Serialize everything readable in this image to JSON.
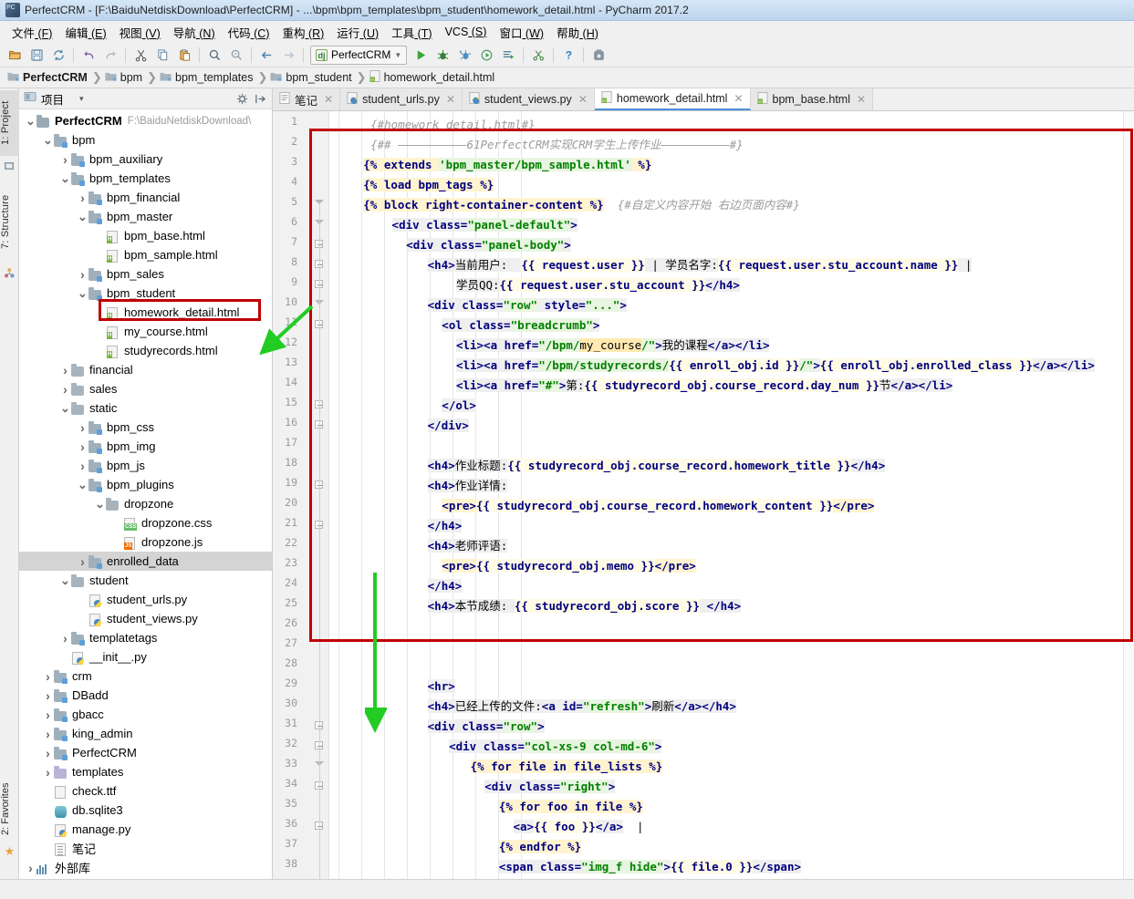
{
  "window": {
    "title": "PerfectCRM - [F:\\BaiduNetdiskDownload\\PerfectCRM] - ...\\bpm\\bpm_templates\\bpm_student\\homework_detail.html - PyCharm 2017.2",
    "app_icon": "pycharm-icon"
  },
  "menubar": {
    "items": [
      {
        "label": "文件",
        "mnemonic": "(F)"
      },
      {
        "label": "编辑",
        "mnemonic": "(E)"
      },
      {
        "label": "视图",
        "mnemonic": "(V)"
      },
      {
        "label": "导航",
        "mnemonic": "(N)"
      },
      {
        "label": "代码",
        "mnemonic": "(C)"
      },
      {
        "label": "重构",
        "mnemonic": "(R)"
      },
      {
        "label": "运行",
        "mnemonic": "(U)"
      },
      {
        "label": "工具",
        "mnemonic": "(T)"
      },
      {
        "label": "VCS",
        "mnemonic": "(S)"
      },
      {
        "label": "窗口",
        "mnemonic": "(W)"
      },
      {
        "label": "帮助",
        "mnemonic": "(H)"
      }
    ]
  },
  "toolbar": {
    "run_config": "PerfectCRM",
    "buttons": [
      "open-folder-icon",
      "save-all-icon",
      "sync-refresh-icon",
      "undo-icon",
      "redo-icon",
      "cut-icon",
      "copy-icon",
      "paste-icon",
      "find-icon",
      "replace-icon",
      "back-icon",
      "forward-icon",
      "run-icon",
      "debug-icon",
      "coverage-icon",
      "profile-icon",
      "run-with-console-icon",
      "stop-icon",
      "help-icon",
      "settings-icon"
    ]
  },
  "navbar": {
    "crumbs": [
      {
        "label": "PerfectCRM",
        "icon": "folder-icon",
        "bold": true
      },
      {
        "label": "bpm",
        "icon": "folder-icon",
        "bold": false
      },
      {
        "label": "bpm_templates",
        "icon": "folder-icon",
        "bold": false
      },
      {
        "label": "bpm_student",
        "icon": "folder-icon",
        "bold": false
      },
      {
        "label": "homework_detail.html",
        "icon": "html-file-icon",
        "bold": false
      }
    ]
  },
  "left_tool_strip": {
    "tabs": [
      {
        "label": "1: Project",
        "selected": true
      },
      {
        "label": "7: Structure",
        "selected": false
      }
    ],
    "bottom_tabs": [
      {
        "label": "2: Favorites",
        "selected": false
      }
    ]
  },
  "project_panel": {
    "title": "项目",
    "gear_icon": "gear-icon",
    "collapse_icon": "collapse-all-icon",
    "tree": [
      {
        "depth": 0,
        "arrow": "down",
        "icon": "folder-src",
        "label": "PerfectCRM",
        "bold": true,
        "path": "F:\\BaiduNetdiskDownload\\"
      },
      {
        "depth": 1,
        "arrow": "down",
        "icon": "folder-mod",
        "label": "bpm"
      },
      {
        "depth": 2,
        "arrow": "right",
        "icon": "folder-mod",
        "label": "bpm_auxiliary"
      },
      {
        "depth": 2,
        "arrow": "down",
        "icon": "folder-mod",
        "label": "bpm_templates"
      },
      {
        "depth": 3,
        "arrow": "right",
        "icon": "folder-mod",
        "label": "bpm_financial"
      },
      {
        "depth": 3,
        "arrow": "down",
        "icon": "folder-mod",
        "label": "bpm_master"
      },
      {
        "depth": 4,
        "arrow": "none",
        "icon": "file-html",
        "label": "bpm_base.html"
      },
      {
        "depth": 4,
        "arrow": "none",
        "icon": "file-html",
        "label": "bpm_sample.html"
      },
      {
        "depth": 3,
        "arrow": "right",
        "icon": "folder-mod",
        "label": "bpm_sales"
      },
      {
        "depth": 3,
        "arrow": "down",
        "icon": "folder-mod",
        "label": "bpm_student"
      },
      {
        "depth": 4,
        "arrow": "none",
        "icon": "file-html",
        "label": "homework_detail.html",
        "highlighted": true
      },
      {
        "depth": 4,
        "arrow": "none",
        "icon": "file-html",
        "label": "my_course.html"
      },
      {
        "depth": 4,
        "arrow": "none",
        "icon": "file-html",
        "label": "studyrecords.html"
      },
      {
        "depth": 2,
        "arrow": "right",
        "icon": "folder-plain",
        "label": "financial"
      },
      {
        "depth": 2,
        "arrow": "right",
        "icon": "folder-plain",
        "label": "sales"
      },
      {
        "depth": 2,
        "arrow": "down",
        "icon": "folder-plain",
        "label": "static"
      },
      {
        "depth": 3,
        "arrow": "right",
        "icon": "folder-mod",
        "label": "bpm_css"
      },
      {
        "depth": 3,
        "arrow": "right",
        "icon": "folder-mod",
        "label": "bpm_img"
      },
      {
        "depth": 3,
        "arrow": "right",
        "icon": "folder-mod",
        "label": "bpm_js"
      },
      {
        "depth": 3,
        "arrow": "down",
        "icon": "folder-mod",
        "label": "bpm_plugins"
      },
      {
        "depth": 4,
        "arrow": "down",
        "icon": "folder-plain",
        "label": "dropzone"
      },
      {
        "depth": 5,
        "arrow": "none",
        "icon": "file-css",
        "label": "dropzone.css"
      },
      {
        "depth": 5,
        "arrow": "none",
        "icon": "file-js",
        "label": "dropzone.js"
      },
      {
        "depth": 3,
        "arrow": "right",
        "icon": "folder-mod",
        "label": "enrolled_data",
        "selected": true
      },
      {
        "depth": 2,
        "arrow": "down",
        "icon": "folder-plain",
        "label": "student"
      },
      {
        "depth": 3,
        "arrow": "none",
        "icon": "file-py",
        "label": "student_urls.py"
      },
      {
        "depth": 3,
        "arrow": "none",
        "icon": "file-py",
        "label": "student_views.py"
      },
      {
        "depth": 2,
        "arrow": "right",
        "icon": "folder-mod",
        "label": "templatetags"
      },
      {
        "depth": 2,
        "arrow": "none",
        "icon": "file-py",
        "label": "__init__.py"
      },
      {
        "depth": 1,
        "arrow": "right",
        "icon": "folder-mod",
        "label": "crm"
      },
      {
        "depth": 1,
        "arrow": "right",
        "icon": "folder-mod",
        "label": "DBadd"
      },
      {
        "depth": 1,
        "arrow": "right",
        "icon": "folder-mod",
        "label": "gbacc"
      },
      {
        "depth": 1,
        "arrow": "right",
        "icon": "folder-mod",
        "label": "king_admin"
      },
      {
        "depth": 1,
        "arrow": "right",
        "icon": "folder-mod",
        "label": "PerfectCRM"
      },
      {
        "depth": 1,
        "arrow": "right",
        "icon": "folder-lav",
        "label": "templates"
      },
      {
        "depth": 1,
        "arrow": "none",
        "icon": "file-ttf",
        "label": "check.ttf"
      },
      {
        "depth": 1,
        "arrow": "none",
        "icon": "file-db",
        "label": "db.sqlite3"
      },
      {
        "depth": 1,
        "arrow": "none",
        "icon": "file-py",
        "label": "manage.py"
      },
      {
        "depth": 1,
        "arrow": "none",
        "icon": "file-txt",
        "label": "笔记"
      },
      {
        "depth": 0,
        "arrow": "right",
        "icon": "library",
        "label": "外部库"
      }
    ]
  },
  "editor": {
    "tabs": [
      {
        "label": "笔记",
        "icon": "txt-file-icon",
        "active": false
      },
      {
        "label": "student_urls.py",
        "icon": "py-file-icon",
        "active": false
      },
      {
        "label": "student_views.py",
        "icon": "py-file-icon",
        "active": false
      },
      {
        "label": "homework_detail.html",
        "icon": "html-file-icon",
        "active": true
      },
      {
        "label": "bpm_base.html",
        "icon": "html-file-icon",
        "active": false
      }
    ],
    "first_line": 1,
    "last_line": 38,
    "lines": [
      {
        "n": 1,
        "html": "<span class='t-cmt'>{#homework_detail.html#}</span>",
        "indent": 5
      },
      {
        "n": 2,
        "html": "<span class='t-cmt'>{## ——————————61PerfectCRM实现CRM学生上传作业——————————#}</span>",
        "indent": 5
      },
      {
        "n": 3,
        "html": "<span class='t-djt'>{% extends </span><span class='t-str'>'bpm_master/bpm_sample.html'</span><span class='t-djt'> %}</span>",
        "indent": 4
      },
      {
        "n": 4,
        "html": "<span class='t-djt'>{% load bpm_tags %}</span>",
        "indent": 4
      },
      {
        "n": 5,
        "html": "<span class='t-djt'>{% block right-container-content %}</span>  <span class='t-cmt'>{#自定义内容开始 右边页面内容#}</span>",
        "indent": 4
      },
      {
        "n": 6,
        "html": "<span class='t-tag'>&lt;div class=</span><span class='t-str'>\"panel-default\"</span><span class='t-tag'>&gt;</span>",
        "indent": 8
      },
      {
        "n": 7,
        "html": "<span class='t-tag'>&lt;div class=</span><span class='t-str'>\"panel-body\"</span><span class='t-tag'>&gt;</span>",
        "indent": 10
      },
      {
        "n": 8,
        "html": "<span class='t-tag'>&lt;h4&gt;</span><span class='t-txt'>当前用户:  </span><span class='t-var'>{{ request.user }}</span><span class='t-txt'> | 学员名字:</span><span class='t-var'>{{ request.user.stu_account.name }}</span><span class='t-txt'> |</span>",
        "indent": 13
      },
      {
        "n": 9,
        "html": "<span class='t-txt'>学员QQ:</span><span class='t-var'>{{ request.user.stu_account }}</span><span class='t-tag'>&lt;/h4&gt;</span>",
        "indent": 17
      },
      {
        "n": 10,
        "html": "<span class='t-tag'>&lt;div class=</span><span class='t-str'>\"row\"</span><span class='t-tag'> style=</span><span class='t-str'>\"...\"</span><span class='t-tag'>&gt;</span>",
        "indent": 13
      },
      {
        "n": 11,
        "html": "<span class='t-tag'>&lt;ol class=</span><span class='t-str'>\"breadcrumb\"</span><span class='t-tag'>&gt;</span>",
        "indent": 15
      },
      {
        "n": 12,
        "html": "<span class='t-tag'>&lt;li&gt;&lt;a href=</span><span class='t-str'>\"/bpm/</span><span class='t-hl2'>my_course</span><span class='t-str'>/\"</span><span class='t-tag'>&gt;</span><span class='t-txt'>我的课程</span><span class='t-tag'>&lt;/a&gt;&lt;/li&gt;</span>",
        "indent": 17
      },
      {
        "n": 13,
        "html": "<span class='t-tag'>&lt;li&gt;&lt;a href=</span><span class='t-str'>\"/bpm/studyrecords/</span><span class='t-var'>{{ enroll_obj.id }}</span><span class='t-str'>/\"</span><span class='t-tag'>&gt;</span><span class='t-var'>{{ enroll_obj.enrolled_class }}</span><span class='t-tag'>&lt;/a&gt;&lt;/li&gt;</span>",
        "indent": 17
      },
      {
        "n": 14,
        "html": "<span class='t-tag'>&lt;li&gt;&lt;a href=</span><span class='t-str'>\"#\"</span><span class='t-tag'>&gt;</span><span class='t-txt'>第:</span><span class='t-var'>{{ studyrecord_obj.course_record.day_num }}</span><span class='t-txt'>节</span><span class='t-tag'>&lt;/a&gt;&lt;/li&gt;</span>",
        "indent": 17
      },
      {
        "n": 15,
        "html": "<span class='t-tag'>&lt;/ol&gt;</span>",
        "indent": 15
      },
      {
        "n": 16,
        "html": "<span class='t-tag'>&lt;/div&gt;</span>",
        "indent": 13
      },
      {
        "n": 17,
        "html": "",
        "indent": 0
      },
      {
        "n": 18,
        "html": "<span class='t-tag'>&lt;h4&gt;</span><span class='t-txt'>作业标题:</span><span class='t-var'>{{ studyrecord_obj.course_record.homework_title }}</span><span class='t-tag'>&lt;/h4&gt;</span>",
        "indent": 13
      },
      {
        "n": 19,
        "html": "<span class='t-tag'>&lt;h4&gt;</span><span class='t-txt'>作业详情:</span>",
        "indent": 13
      },
      {
        "n": 20,
        "html": "<span class='t-pre'>&lt;pre&gt;</span><span class='t-var'>{{ studyrecord_obj.course_record.homework_content }}</span><span class='t-pre'>&lt;/pre&gt;</span>",
        "indent": 15
      },
      {
        "n": 21,
        "html": "<span class='t-tag'>&lt;/h4&gt;</span>",
        "indent": 13
      },
      {
        "n": 22,
        "html": "<span class='t-tag'>&lt;h4&gt;</span><span class='t-txt'>老师评语:</span>",
        "indent": 13
      },
      {
        "n": 23,
        "html": "<span class='t-pre'>&lt;pre&gt;</span><span class='t-var'>{{ studyrecord_obj.memo }}</span><span class='t-pre'>&lt;/pre&gt;</span>",
        "indent": 15
      },
      {
        "n": 24,
        "html": "<span class='t-tag'>&lt;/h4&gt;</span>",
        "indent": 13
      },
      {
        "n": 25,
        "html": "<span class='t-tag'>&lt;h4&gt;</span><span class='t-txt'>本节成绩: </span><span class='t-var'>{{ studyrecord_obj.score }}</span><span class='t-txt'> </span><span class='t-tag'>&lt;/h4&gt;</span>",
        "indent": 13
      },
      {
        "n": 26,
        "html": "",
        "indent": 0
      },
      {
        "n": 27,
        "html": "",
        "indent": 0
      },
      {
        "n": 28,
        "html": "",
        "indent": 0
      },
      {
        "n": 29,
        "html": "<span class='t-tag'>&lt;hr&gt;</span>",
        "indent": 13
      },
      {
        "n": 30,
        "html": "<span class='t-tag'>&lt;h4&gt;</span><span class='t-txt'>已经上传的文件:</span><span class='t-tag'>&lt;a id=</span><span class='t-str'>\"refresh\"</span><span class='t-tag'>&gt;</span><span class='t-txt'>刷新</span><span class='t-tag'>&lt;/a&gt;&lt;/h4&gt;</span>",
        "indent": 13
      },
      {
        "n": 31,
        "html": "<span class='t-tag'>&lt;div class=</span><span class='t-str'>\"row\"</span><span class='t-tag'>&gt;</span>",
        "indent": 13
      },
      {
        "n": 32,
        "html": "<span class='t-tag'>&lt;div class=</span><span class='t-str'>\"col-xs-9 col-md-6\"</span><span class='t-tag'>&gt;</span>",
        "indent": 16
      },
      {
        "n": 33,
        "html": "<span class='t-djt'>{% for file in file_lists %}</span>",
        "indent": 19
      },
      {
        "n": 34,
        "html": "<span class='t-tag'>&lt;div class=</span><span class='t-str'>\"right\"</span><span class='t-tag'>&gt;</span>",
        "indent": 21
      },
      {
        "n": 35,
        "html": "<span class='t-djt'>{% for foo in file %}</span>",
        "indent": 23
      },
      {
        "n": 36,
        "html": "<span class='t-tag'>&lt;a&gt;</span><span class='t-var'>{{ foo }}</span><span class='t-tag'>&lt;/a&gt;</span>  |",
        "indent": 25
      },
      {
        "n": 37,
        "html": "<span class='t-djt'>{% endfor %}</span>",
        "indent": 23
      },
      {
        "n": 38,
        "html": "<span class='t-tag'>&lt;span class=</span><span class='t-str'>\"img_f hide\"</span><span class='t-tag'>&gt;</span><span class='t-var'>{{ file.0 }}</span><span class='t-tag'>&lt;/span&gt;</span>",
        "indent": 23
      }
    ]
  },
  "annotations": {
    "box_color": "#c00000",
    "arrow_color": "#22cc22",
    "highlight_box_color": "#c00000"
  },
  "statusbar": {
    "text": ""
  }
}
